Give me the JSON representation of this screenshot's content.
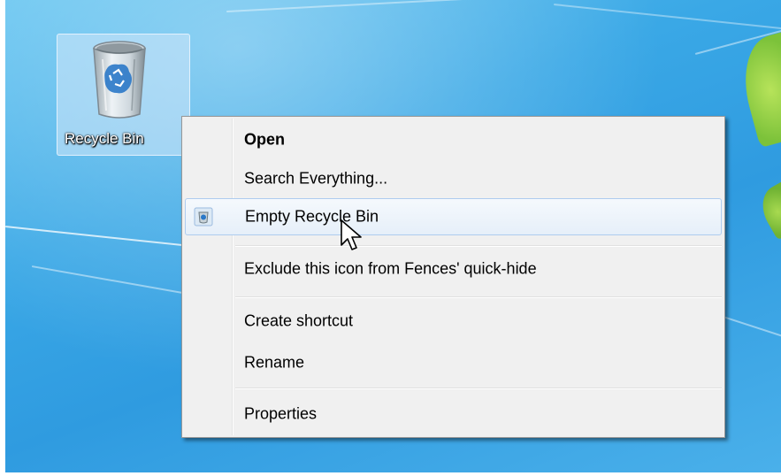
{
  "desktop": {
    "icon": {
      "label": "Recycle Bin",
      "icon": "recycle-bin-icon"
    }
  },
  "context_menu": {
    "items": [
      {
        "label": "Open",
        "bold": true
      },
      {
        "label": "Search Everything..."
      },
      {
        "label": "Empty Recycle Bin",
        "icon": "recycle-bin-icon",
        "hovered": true
      },
      {
        "label": "Exclude this icon from Fences' quick-hide"
      },
      {
        "label": "Create shortcut"
      },
      {
        "label": "Rename"
      },
      {
        "label": "Properties"
      }
    ]
  },
  "colors": {
    "desktop_blue": "#3aa8e6",
    "menu_background": "#f0f0f0",
    "hover_border": "#aeccef"
  }
}
